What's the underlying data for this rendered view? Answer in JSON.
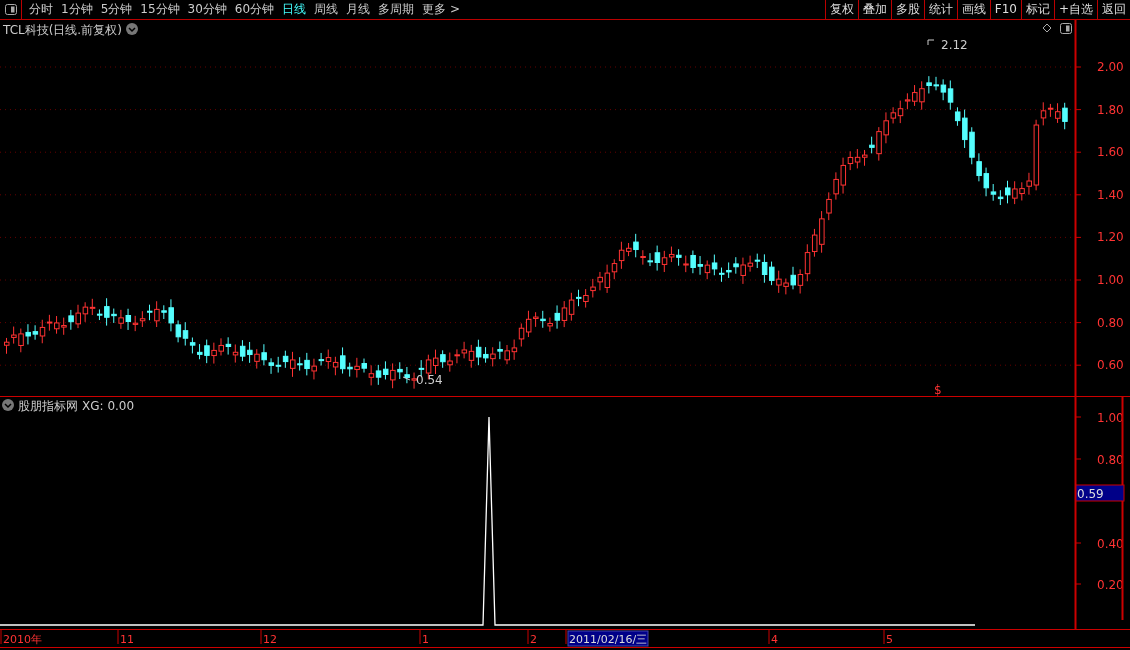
{
  "toolbar": {
    "periods": [
      {
        "label": "分时",
        "selected": false
      },
      {
        "label": "1分钟",
        "selected": false
      },
      {
        "label": "5分钟",
        "selected": false
      },
      {
        "label": "15分钟",
        "selected": false
      },
      {
        "label": "30分钟",
        "selected": false
      },
      {
        "label": "60分钟",
        "selected": false
      },
      {
        "label": "日线",
        "selected": true
      },
      {
        "label": "周线",
        "selected": false
      },
      {
        "label": "月线",
        "selected": false
      },
      {
        "label": "多周期",
        "selected": false
      },
      {
        "label": "更多 >",
        "selected": false
      }
    ],
    "actions": [
      "复权",
      "叠加",
      "多股",
      "统计",
      "画线",
      "F10",
      "标记",
      "+自选",
      "返回"
    ]
  },
  "main_chart": {
    "title": "TCL科技(日线.前复权)",
    "y_axis": [
      "2.00",
      "1.80",
      "1.60",
      "1.40",
      "1.20",
      "1.00",
      "0.80",
      "0.60"
    ],
    "high_label": "2.12",
    "low_label": "0.54",
    "marker": "$"
  },
  "indicator": {
    "title": "股朋指标网",
    "reading": "XG: 0.00",
    "y_axis": [
      "1.00",
      "0.80",
      "0.40",
      "0.20"
    ],
    "cursor_value": "0.59"
  },
  "date_axis": {
    "labels": [
      {
        "text": "2010年",
        "selected": false
      },
      {
        "text": "11",
        "selected": false
      },
      {
        "text": "12",
        "selected": false
      },
      {
        "text": "1",
        "selected": false
      },
      {
        "text": "2",
        "selected": false
      },
      {
        "text": "2011/02/16/三",
        "selected": true
      },
      {
        "text": "4",
        "selected": false
      },
      {
        "text": "5",
        "selected": false
      }
    ]
  }
}
